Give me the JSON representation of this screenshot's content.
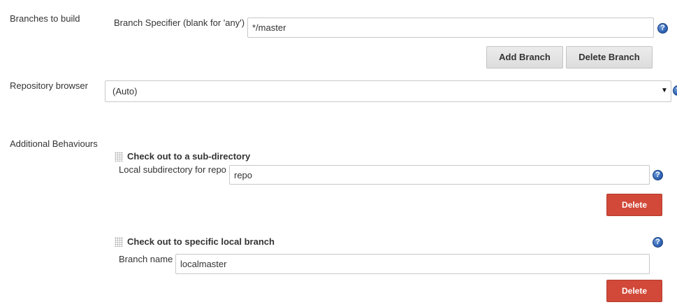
{
  "branches": {
    "section_label": "Branches to build",
    "specifier_label": "Branch Specifier (blank for 'any')",
    "specifier_value": "*/master",
    "add_branch": "Add Branch",
    "delete_branch": "Delete Branch",
    "help_icon": "help-icon"
  },
  "repository_browser": {
    "label": "Repository browser",
    "selected": "(Auto)",
    "arrow_glyph": "▼"
  },
  "additional_behaviours": {
    "label": "Additional Behaviours",
    "subdirectory": {
      "title": "Check out to a sub-directory",
      "field_label": "Local subdirectory for repo",
      "field_value": "repo",
      "delete_label": "Delete"
    },
    "local_branch": {
      "title": "Check out to specific local branch",
      "field_label": "Branch name",
      "field_value": "localmaster",
      "delete_label": "Delete"
    }
  },
  "help_glyph": "?",
  "colors": {
    "danger": "#d24939",
    "help_blue": "#3468b8"
  }
}
